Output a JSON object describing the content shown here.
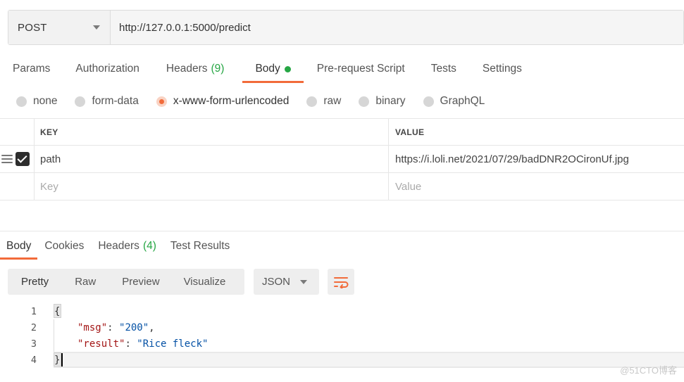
{
  "request": {
    "method": "POST",
    "url": "http://127.0.0.1:5000/predict"
  },
  "request_tabs": [
    {
      "label": "Params"
    },
    {
      "label": "Authorization"
    },
    {
      "label": "Headers",
      "count": "(9)"
    },
    {
      "label": "Body",
      "active": true
    },
    {
      "label": "Pre-request Script"
    },
    {
      "label": "Tests"
    },
    {
      "label": "Settings"
    }
  ],
  "body_types": [
    {
      "label": "none"
    },
    {
      "label": "form-data"
    },
    {
      "label": "x-www-form-urlencoded",
      "selected": true
    },
    {
      "label": "raw"
    },
    {
      "label": "binary"
    },
    {
      "label": "GraphQL"
    }
  ],
  "kv_table": {
    "key_header": "KEY",
    "value_header": "VALUE",
    "rows": [
      {
        "key": "path",
        "value": "https://i.loli.net/2021/07/29/badDNR2OCironUf.jpg",
        "checked": true
      }
    ],
    "placeholder_key": "Key",
    "placeholder_value": "Value"
  },
  "response_tabs": [
    {
      "label": "Body",
      "active": true
    },
    {
      "label": "Cookies"
    },
    {
      "label": "Headers",
      "count": "(4)"
    },
    {
      "label": "Test Results"
    }
  ],
  "view_modes": [
    "Pretty",
    "Raw",
    "Preview",
    "Visualize"
  ],
  "active_view": "Pretty",
  "format": "JSON",
  "code": {
    "line_numbers": [
      "1",
      "2",
      "3",
      "4"
    ],
    "open_brace": "{",
    "close_brace": "}",
    "msg_key": "\"msg\"",
    "msg_value": "\"200\"",
    "result_key": "\"result\"",
    "result_value": "\"Rice fleck\""
  },
  "watermark": "@51CTO博客",
  "colors": {
    "accent": "#f26b3a",
    "green": "#26a644"
  }
}
